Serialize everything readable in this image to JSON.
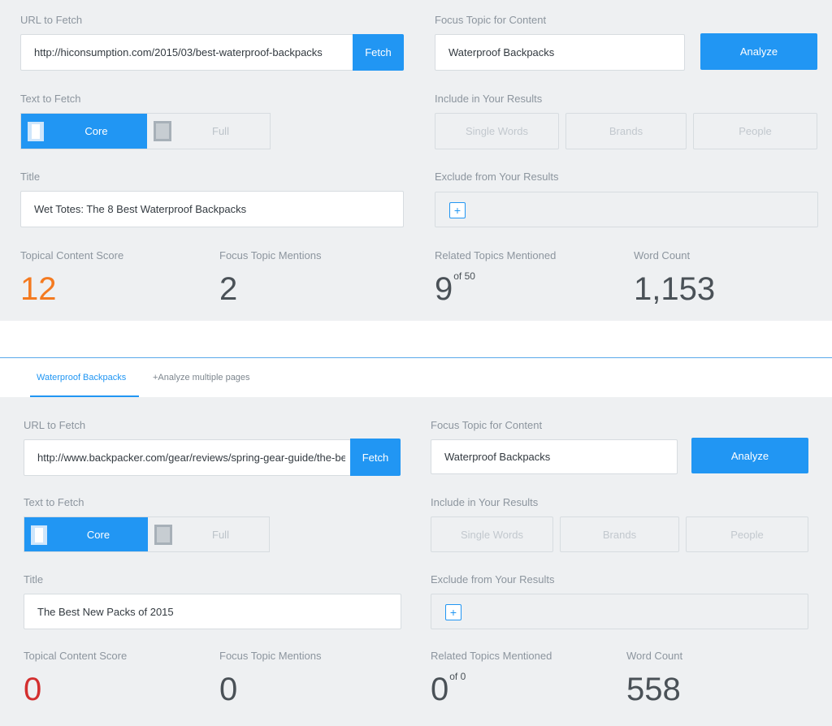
{
  "colors": {
    "accent": "#2196f3",
    "score_orange": "#f47a20",
    "score_red": "#d32f2f",
    "panel_bg": "#eef0f2"
  },
  "labels": {
    "url_to_fetch": "URL to Fetch",
    "focus_topic": "Focus Topic for Content",
    "text_to_fetch": "Text to Fetch",
    "include_results": "Include in Your Results",
    "title": "Title",
    "exclude_results": "Exclude from Your Results",
    "topical_score": "Topical Content Score",
    "focus_mentions": "Focus Topic Mentions",
    "related_topics": "Related Topics Mentioned",
    "word_count": "Word Count"
  },
  "buttons": {
    "fetch": "Fetch",
    "analyze": "Analyze",
    "core": "Core",
    "full": "Full",
    "single_words": "Single Words",
    "brands": "Brands",
    "people": "People",
    "plus": "+"
  },
  "panel1": {
    "url": "http://hiconsumption.com/2015/03/best-waterproof-backpacks",
    "focus_topic": "Waterproof Backpacks",
    "title": "Wet Totes: The 8 Best Waterproof Backpacks",
    "topical_score": "12",
    "focus_mentions": "2",
    "related_topics": "9",
    "related_of": "of 50",
    "word_count": "1,153"
  },
  "tabs": {
    "active": "Waterproof Backpacks",
    "add": "+Analyze multiple pages"
  },
  "panel2": {
    "url": "http://www.backpacker.com/gear/reviews/spring-gear-guide/the-best-new-packs",
    "focus_topic": "Waterproof Backpacks",
    "title": "The Best New Packs of 2015",
    "topical_score": "0",
    "focus_mentions": "0",
    "related_topics": "0",
    "related_of": "of 0",
    "word_count": "558"
  }
}
